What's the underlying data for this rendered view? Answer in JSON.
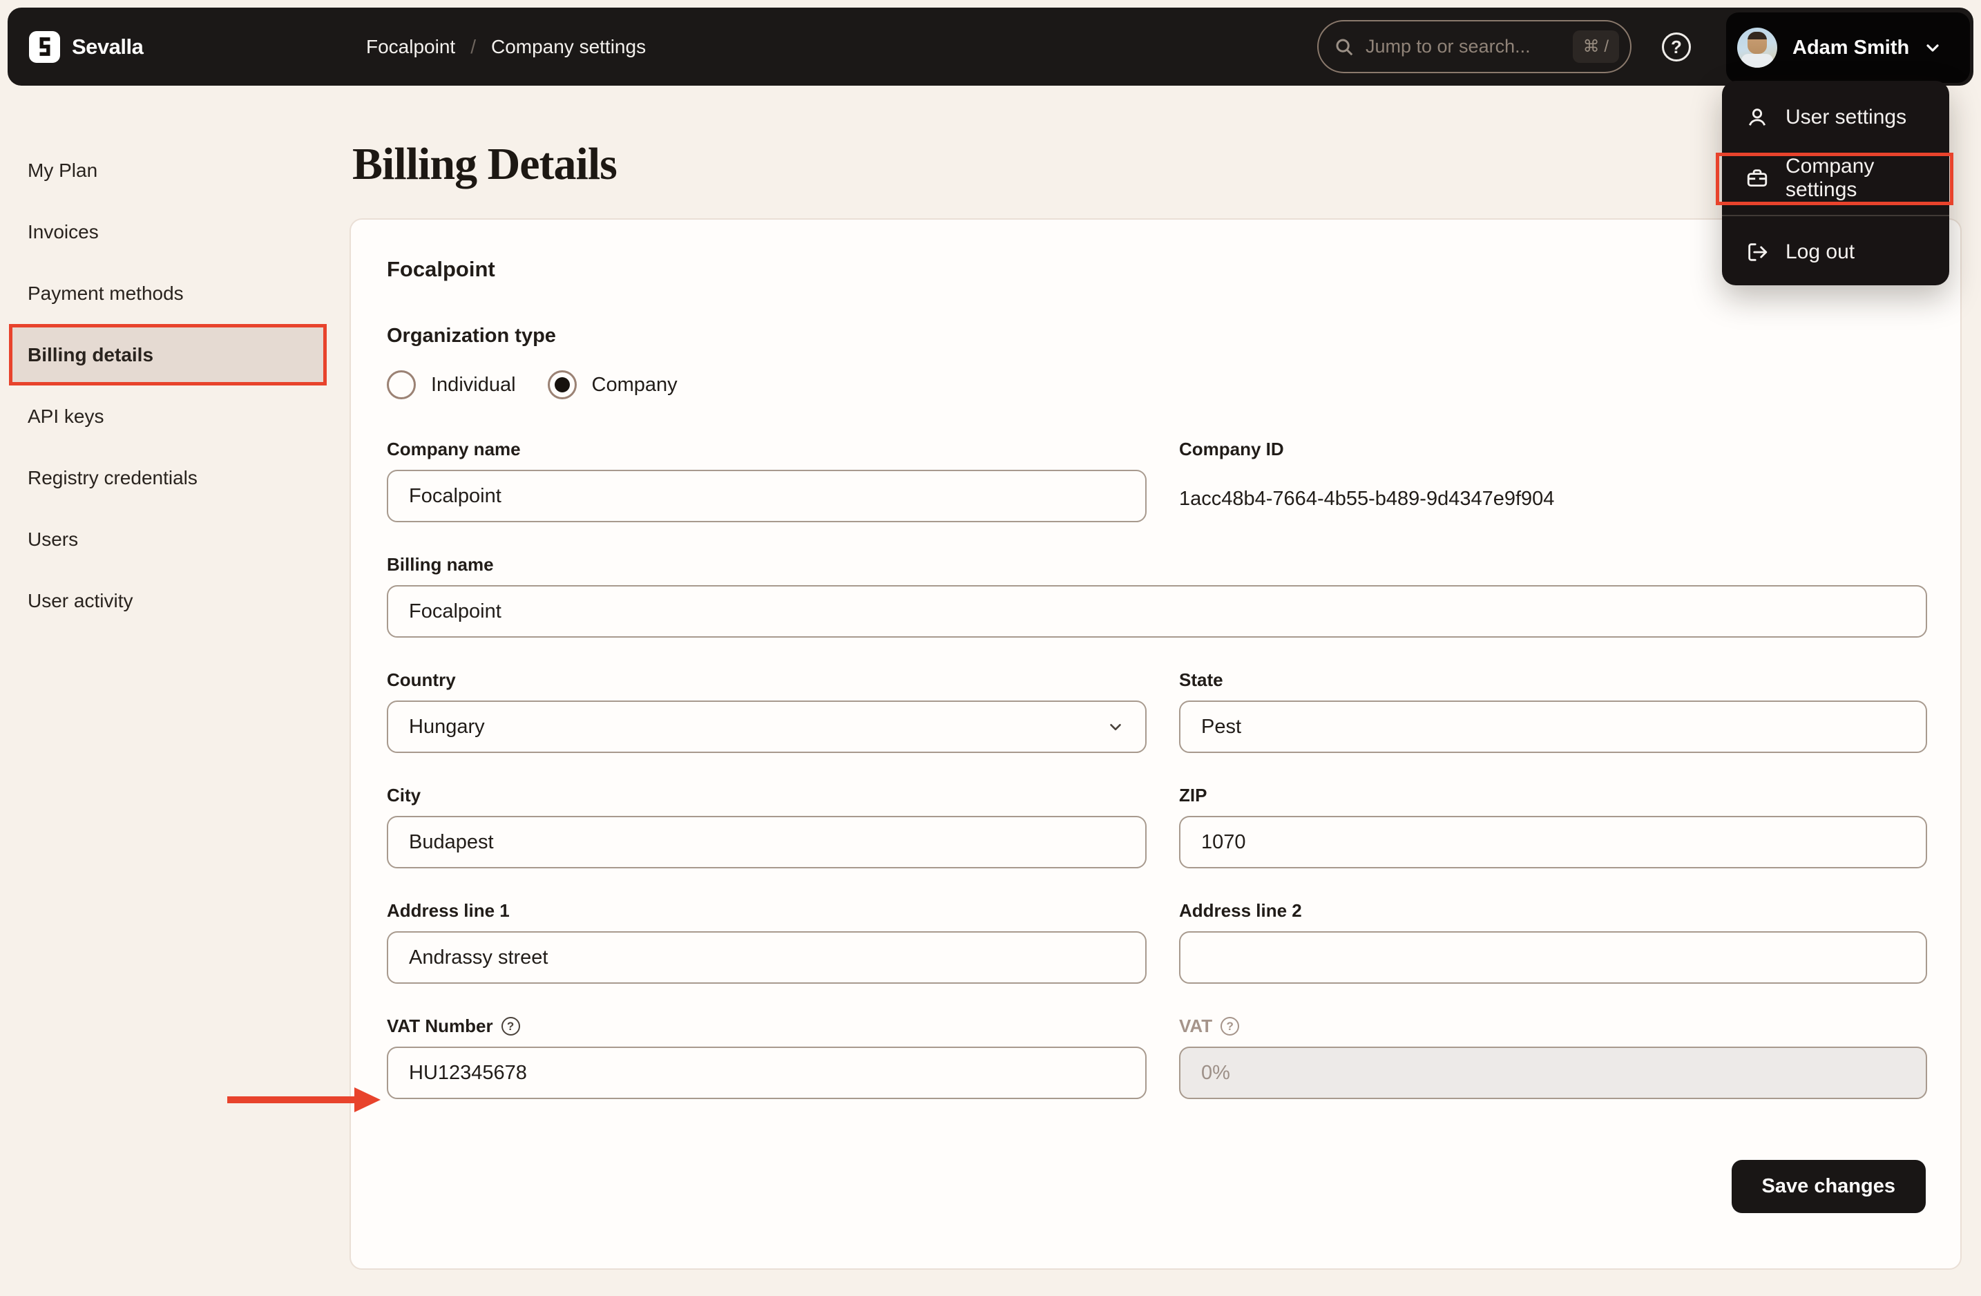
{
  "topbar": {
    "brand": "Sevalla",
    "breadcrumb": {
      "project": "Focalpoint",
      "separator": "/",
      "section": "Company settings"
    },
    "search": {
      "placeholder": "Jump to or search...",
      "shortcut": "⌘ /"
    },
    "help_label": "?",
    "user": {
      "name": "Adam Smith"
    }
  },
  "user_menu": {
    "items": [
      {
        "label": "User settings"
      },
      {
        "label": "Company settings",
        "highlighted": true
      },
      {
        "label": "Log out"
      }
    ]
  },
  "sidebar": {
    "items": [
      {
        "label": "My Plan"
      },
      {
        "label": "Invoices"
      },
      {
        "label": "Payment methods"
      },
      {
        "label": "Billing details",
        "active": true
      },
      {
        "label": "API keys"
      },
      {
        "label": "Registry credentials"
      },
      {
        "label": "Users"
      },
      {
        "label": "User activity"
      }
    ]
  },
  "page": {
    "title": "Billing Details"
  },
  "card": {
    "title": "Focalpoint",
    "organization_type": {
      "label": "Organization type",
      "options": [
        {
          "label": "Individual",
          "selected": false
        },
        {
          "label": "Company",
          "selected": true
        }
      ]
    },
    "fields": {
      "company_name": {
        "label": "Company name",
        "value": "Focalpoint"
      },
      "company_id": {
        "label": "Company ID",
        "value": "1acc48b4-7664-4b55-b489-9d4347e9f904"
      },
      "billing_name": {
        "label": "Billing name",
        "value": "Focalpoint"
      },
      "country": {
        "label": "Country",
        "value": "Hungary"
      },
      "state": {
        "label": "State",
        "value": "Pest"
      },
      "city": {
        "label": "City",
        "value": "Budapest"
      },
      "zip": {
        "label": "ZIP",
        "value": "1070"
      },
      "address_line_1": {
        "label": "Address line 1",
        "value": "Andrassy street"
      },
      "address_line_2": {
        "label": "Address line 2",
        "value": ""
      },
      "vat_number": {
        "label": "VAT Number",
        "value": "HU12345678"
      },
      "vat": {
        "label": "VAT",
        "value": "0%",
        "disabled": true
      }
    },
    "save_label": "Save changes"
  },
  "colors": {
    "page_background": "#f7f1ea",
    "topbar_background": "#1b1817",
    "card_background": "#fffdfb",
    "input_border": "#a89a8e",
    "annotation_red": "#e8432c",
    "active_item_background": "#e5dad2",
    "save_button_background": "#191615"
  }
}
